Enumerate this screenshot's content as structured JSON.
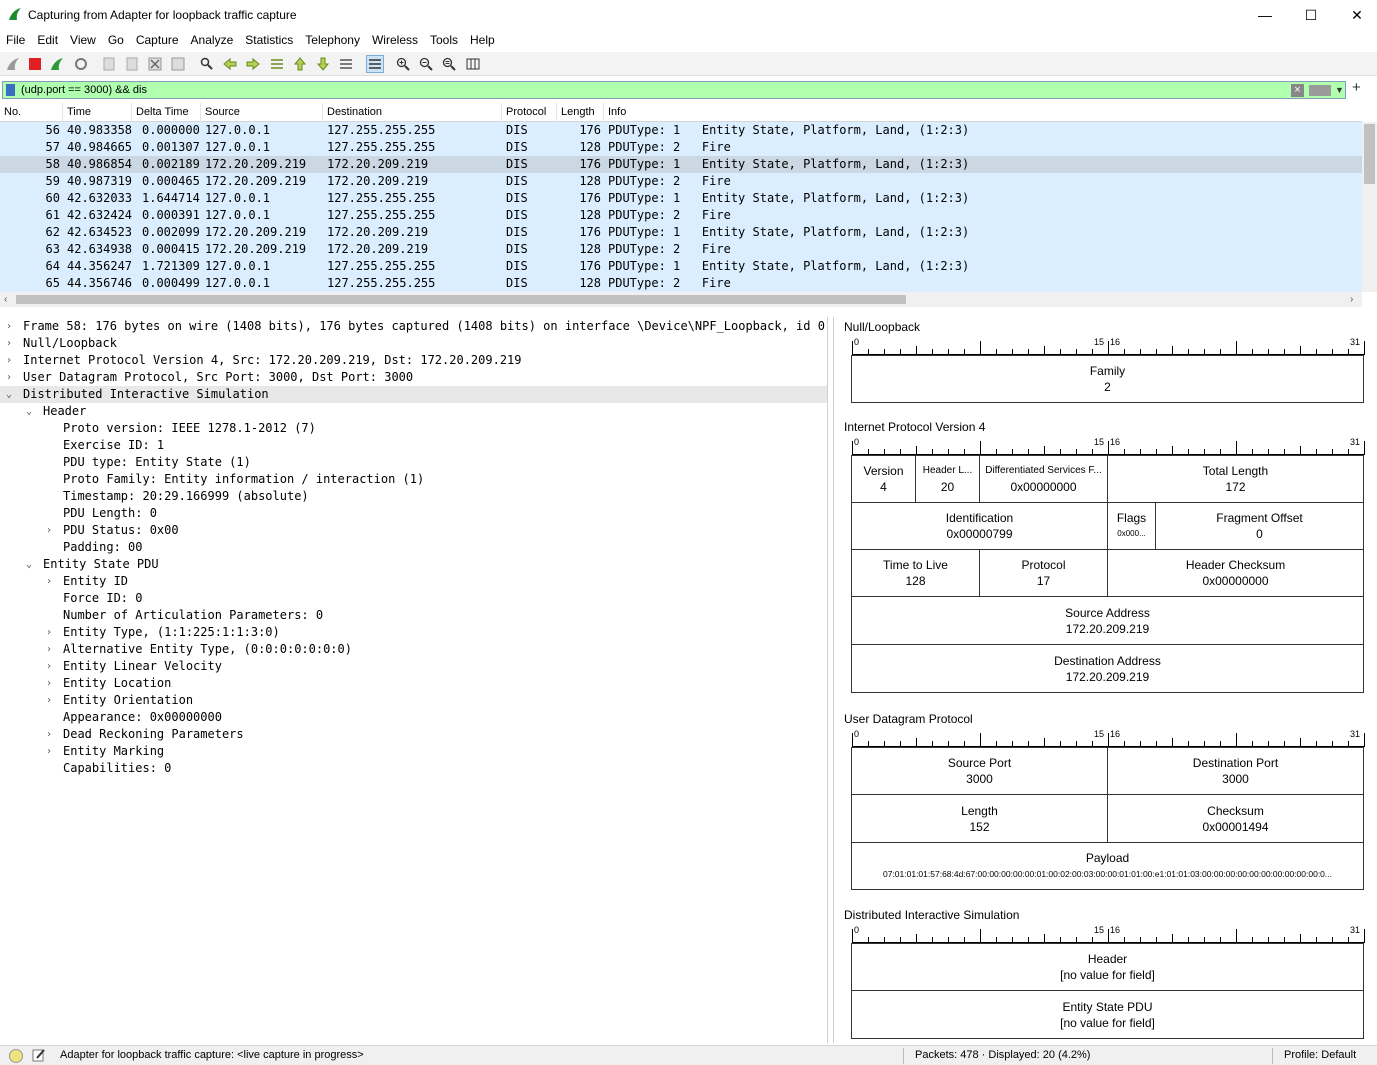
{
  "window": {
    "title": "Capturing from Adapter for loopback traffic capture",
    "minimize": "—",
    "maximize": "☐",
    "close": "✕"
  },
  "menu": [
    "File",
    "Edit",
    "View",
    "Go",
    "Capture",
    "Analyze",
    "Statistics",
    "Telephony",
    "Wireless",
    "Tools",
    "Help"
  ],
  "filter": {
    "value": "(udp.port == 3000) && dis"
  },
  "columns": [
    "No.",
    "Time",
    "Delta Time",
    "Source",
    "Destination",
    "Protocol",
    "Length",
    "Info"
  ],
  "packets": [
    {
      "no": "56",
      "time": "40.983358",
      "delta": "0.000000",
      "src": "127.0.0.1",
      "dst": "127.255.255.255",
      "proto": "DIS",
      "len": "176",
      "info": "PDUType: 1   Entity State, Platform, Land, (1:2:3)"
    },
    {
      "no": "57",
      "time": "40.984665",
      "delta": "0.001307",
      "src": "127.0.0.1",
      "dst": "127.255.255.255",
      "proto": "DIS",
      "len": "128",
      "info": "PDUType: 2   Fire"
    },
    {
      "no": "58",
      "time": "40.986854",
      "delta": "0.002189",
      "src": "172.20.209.219",
      "dst": "172.20.209.219",
      "proto": "DIS",
      "len": "176",
      "info": "PDUType: 1   Entity State, Platform, Land, (1:2:3)"
    },
    {
      "no": "59",
      "time": "40.987319",
      "delta": "0.000465",
      "src": "172.20.209.219",
      "dst": "172.20.209.219",
      "proto": "DIS",
      "len": "128",
      "info": "PDUType: 2   Fire"
    },
    {
      "no": "60",
      "time": "42.632033",
      "delta": "1.644714",
      "src": "127.0.0.1",
      "dst": "127.255.255.255",
      "proto": "DIS",
      "len": "176",
      "info": "PDUType: 1   Entity State, Platform, Land, (1:2:3)"
    },
    {
      "no": "61",
      "time": "42.632424",
      "delta": "0.000391",
      "src": "127.0.0.1",
      "dst": "127.255.255.255",
      "proto": "DIS",
      "len": "128",
      "info": "PDUType: 2   Fire"
    },
    {
      "no": "62",
      "time": "42.634523",
      "delta": "0.002099",
      "src": "172.20.209.219",
      "dst": "172.20.209.219",
      "proto": "DIS",
      "len": "176",
      "info": "PDUType: 1   Entity State, Platform, Land, (1:2:3)"
    },
    {
      "no": "63",
      "time": "42.634938",
      "delta": "0.000415",
      "src": "172.20.209.219",
      "dst": "172.20.209.219",
      "proto": "DIS",
      "len": "128",
      "info": "PDUType: 2   Fire"
    },
    {
      "no": "64",
      "time": "44.356247",
      "delta": "1.721309",
      "src": "127.0.0.1",
      "dst": "127.255.255.255",
      "proto": "DIS",
      "len": "176",
      "info": "PDUType: 1   Entity State, Platform, Land, (1:2:3)"
    },
    {
      "no": "65",
      "time": "44.356746",
      "delta": "0.000499",
      "src": "127.0.0.1",
      "dst": "127.255.255.255",
      "proto": "DIS",
      "len": "128",
      "info": "PDUType: 2   Fire"
    }
  ],
  "selected_packet": "58",
  "tree": [
    {
      "text": "Frame 58: 176 bytes on wire (1408 bits), 176 bytes captured (1408 bits) on interface \\Device\\NPF_Loopback, id 0",
      "depth": 0,
      "arrow": "›"
    },
    {
      "text": "Null/Loopback",
      "depth": 0,
      "arrow": "›"
    },
    {
      "text": "Internet Protocol Version 4, Src: 172.20.209.219, Dst: 172.20.209.219",
      "depth": 0,
      "arrow": "›"
    },
    {
      "text": "User Datagram Protocol, Src Port: 3000, Dst Port: 3000",
      "depth": 0,
      "arrow": "›"
    },
    {
      "text": "Distributed Interactive Simulation",
      "depth": 0,
      "arrow": "⌄"
    },
    {
      "text": "Header",
      "depth": 1,
      "arrow": "⌄"
    },
    {
      "text": "Proto version: IEEE 1278.1-2012 (7)",
      "depth": 2,
      "arrow": ""
    },
    {
      "text": "Exercise ID: 1",
      "depth": 2,
      "arrow": ""
    },
    {
      "text": "PDU type: Entity State (1)",
      "depth": 2,
      "arrow": ""
    },
    {
      "text": "Proto Family: Entity information / interaction (1)",
      "depth": 2,
      "arrow": ""
    },
    {
      "text": "Timestamp: 20:29.166999 (absolute)",
      "depth": 2,
      "arrow": ""
    },
    {
      "text": "PDU Length: 0",
      "depth": 2,
      "arrow": ""
    },
    {
      "text": "PDU Status: 0x00",
      "depth": 2,
      "arrow": "›"
    },
    {
      "text": "Padding: 00",
      "depth": 2,
      "arrow": ""
    },
    {
      "text": "Entity State PDU",
      "depth": 1,
      "arrow": "⌄"
    },
    {
      "text": "Entity ID",
      "depth": 2,
      "arrow": "›"
    },
    {
      "text": "Force ID: 0",
      "depth": 2,
      "arrow": ""
    },
    {
      "text": "Number of Articulation Parameters: 0",
      "depth": 2,
      "arrow": ""
    },
    {
      "text": "Entity Type, (1:1:225:1:1:3:0)",
      "depth": 2,
      "arrow": "›"
    },
    {
      "text": "Alternative Entity Type, (0:0:0:0:0:0:0)",
      "depth": 2,
      "arrow": "›"
    },
    {
      "text": "Entity Linear Velocity",
      "depth": 2,
      "arrow": "›"
    },
    {
      "text": "Entity Location",
      "depth": 2,
      "arrow": "›"
    },
    {
      "text": "Entity Orientation",
      "depth": 2,
      "arrow": "›"
    },
    {
      "text": "Appearance: 0x00000000",
      "depth": 2,
      "arrow": ""
    },
    {
      "text": "Dead Reckoning Parameters",
      "depth": 2,
      "arrow": "›"
    },
    {
      "text": "Entity Marking",
      "depth": 2,
      "arrow": "›"
    },
    {
      "text": "Capabilities: 0",
      "depth": 2,
      "arrow": ""
    }
  ],
  "diagram": {
    "ruler_labels": {
      "start": "0",
      "mid_a": "15",
      "mid_b": "16",
      "end": "31"
    },
    "null_loopback": {
      "title": "Null/Loopback",
      "family_label": "Family",
      "family_value": "2"
    },
    "ipv4": {
      "title": "Internet Protocol Version 4",
      "version": {
        "label": "Version",
        "value": "4"
      },
      "ihl": {
        "label": "Header L...",
        "value": "20"
      },
      "dsf": {
        "label": "Differentiated Services F...",
        "value": "0x00000000"
      },
      "total_length": {
        "label": "Total Length",
        "value": "172"
      },
      "identification": {
        "label": "Identification",
        "value": "0x00000799"
      },
      "flags": {
        "label": "Flags",
        "value": "0x000..."
      },
      "frag_offset": {
        "label": "Fragment Offset",
        "value": "0"
      },
      "ttl": {
        "label": "Time to Live",
        "value": "128"
      },
      "protocol": {
        "label": "Protocol",
        "value": "17"
      },
      "checksum": {
        "label": "Header Checksum",
        "value": "0x00000000"
      },
      "src": {
        "label": "Source Address",
        "value": "172.20.209.219"
      },
      "dst": {
        "label": "Destination Address",
        "value": "172.20.209.219"
      }
    },
    "udp": {
      "title": "User Datagram Protocol",
      "src_port": {
        "label": "Source Port",
        "value": "3000"
      },
      "dst_port": {
        "label": "Destination Port",
        "value": "3000"
      },
      "length": {
        "label": "Length",
        "value": "152"
      },
      "checksum": {
        "label": "Checksum",
        "value": "0x00001494"
      },
      "payload": {
        "label": "Payload",
        "value": "07:01:01:01:57:68:4d:67:00:00:00:00:00:01:00:02:00:03:00:00:01:01:00:e1:01:01:03:00:00:00:00:00:00:00:00:00:00:0..."
      }
    },
    "dis": {
      "title": "Distributed Interactive Simulation",
      "header": {
        "label": "Header",
        "value": "[no value for field]"
      },
      "es_pdu": {
        "label": "Entity State PDU",
        "value": "[no value for field]"
      }
    }
  },
  "status": {
    "message": "Adapter for loopback traffic capture: <live capture in progress>",
    "packets": "Packets: 478 · Displayed: 20 (4.2%)",
    "profile": "Profile: Default"
  }
}
